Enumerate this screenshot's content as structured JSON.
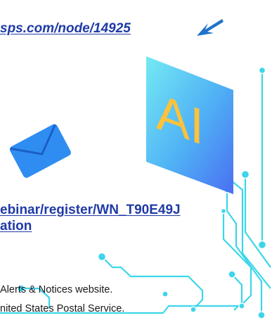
{
  "links": {
    "top_url": "sps.com/node/14925",
    "webinar_url_line1": "ebinar/register/WN_T90E49J",
    "webinar_url_line2": "ation"
  },
  "body_text": {
    "line1": "Alerts & Notices website.",
    "line2": "nited States Postal Service."
  },
  "graphics": {
    "ai_card_text": "AI",
    "arrow_icon": "arrow-pointing-left-icon",
    "envelope_icon": "envelope-icon"
  },
  "colors": {
    "link": "#1f3aa6",
    "accent_blue": "#1e73c8",
    "circuit_cyan": "#3cd6ea",
    "ai_letters": "#ffc23a"
  }
}
